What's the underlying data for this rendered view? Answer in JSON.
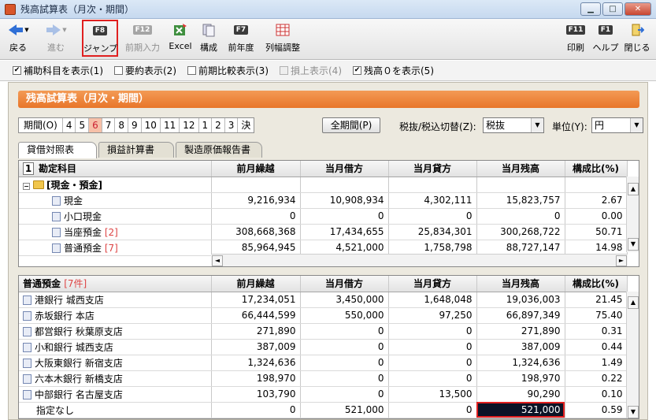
{
  "window": {
    "title": "残高試算表（月次・期間）"
  },
  "toolbar": {
    "back": "戻る",
    "forward": "進む",
    "jump_key": "F8",
    "jump": "ジャンプ",
    "prev_key": "F12",
    "prev_input": "前期入力",
    "excel": "Excel",
    "compose": "構成",
    "prevyear_key": "F7",
    "prevyear": "前年度",
    "colwidth": "列幅調整",
    "print_key": "F11",
    "print": "印刷",
    "help_key": "F1",
    "help": "ヘルプ",
    "close": "閉じる"
  },
  "options": [
    {
      "label": "補助科目を表示(1)",
      "checked": true,
      "enabled": true
    },
    {
      "label": "要約表示(2)",
      "checked": false,
      "enabled": true
    },
    {
      "label": "前期比較表示(3)",
      "checked": false,
      "enabled": true
    },
    {
      "label": "損上表示(4)",
      "checked": false,
      "enabled": false
    },
    {
      "label": "残高０を表示(5)",
      "checked": true,
      "enabled": true
    }
  ],
  "banner": "残高試算表（月次・期間）",
  "period": {
    "label": "期間(O)",
    "months": [
      "4",
      "5",
      "6",
      "7",
      "8",
      "9",
      "10",
      "11",
      "12",
      "1",
      "2",
      "3",
      "決"
    ],
    "selected": "6",
    "all_button": "全期間(P)",
    "tax_label": "税抜/税込切替(Z):",
    "tax_value": "税抜",
    "unit_label": "単位(Y):",
    "unit_value": "円"
  },
  "tabs": [
    "貸借対照表",
    "損益計算書",
    "製造原価報告書"
  ],
  "grid1": {
    "headers": [
      "勘定科目",
      "前月繰越",
      "当月借方",
      "当月貸方",
      "当月残高",
      "構成比(%)"
    ],
    "index": "1",
    "group": "[現金・預金]",
    "rows": [
      {
        "name": "現金",
        "count": "",
        "c1": "9,216,934",
        "c2": "10,908,934",
        "c3": "4,302,111",
        "c4": "15,823,757",
        "c5": "2.67"
      },
      {
        "name": "小口現金",
        "count": "",
        "c1": "0",
        "c2": "0",
        "c3": "0",
        "c4": "0",
        "c5": "0.00"
      },
      {
        "name": "当座預金",
        "count": "[2]",
        "c1": "308,668,368",
        "c2": "17,434,655",
        "c3": "25,834,301",
        "c4": "300,268,722",
        "c5": "50.71"
      },
      {
        "name": "普通預金",
        "count": "[7]",
        "c1": "85,964,945",
        "c2": "4,521,000",
        "c3": "1,758,798",
        "c4": "88,727,147",
        "c5": "14.98"
      }
    ]
  },
  "grid2": {
    "title": "普通預金",
    "title_count": "[7件]",
    "headers": [
      "前月繰越",
      "当月借方",
      "当月貸方",
      "当月残高",
      "構成比(%)"
    ],
    "rows": [
      {
        "name": "港銀行 城西支店",
        "c1": "17,234,051",
        "c2": "3,450,000",
        "c3": "1,648,048",
        "c4": "19,036,003",
        "c5": "21.45"
      },
      {
        "name": "赤坂銀行 本店",
        "c1": "66,444,599",
        "c2": "550,000",
        "c3": "97,250",
        "c4": "66,897,349",
        "c5": "75.40"
      },
      {
        "name": "都営銀行 秋葉原支店",
        "c1": "271,890",
        "c2": "0",
        "c3": "0",
        "c4": "271,890",
        "c5": "0.31"
      },
      {
        "name": "小和銀行 城西支店",
        "c1": "387,009",
        "c2": "0",
        "c3": "0",
        "c4": "387,009",
        "c5": "0.44"
      },
      {
        "name": "大阪東銀行 新宿支店",
        "c1": "1,324,636",
        "c2": "0",
        "c3": "0",
        "c4": "1,324,636",
        "c5": "1.49"
      },
      {
        "name": "六本木銀行 新橋支店",
        "c1": "198,970",
        "c2": "0",
        "c3": "0",
        "c4": "198,970",
        "c5": "0.22"
      },
      {
        "name": "中部銀行 名古屋支店",
        "c1": "103,790",
        "c2": "0",
        "c3": "13,500",
        "c4": "90,290",
        "c5": "0.10"
      }
    ],
    "last": {
      "name": "指定なし",
      "c1": "0",
      "c2": "521,000",
      "c3": "0",
      "c4": "521,000",
      "c5": "0.59"
    }
  }
}
